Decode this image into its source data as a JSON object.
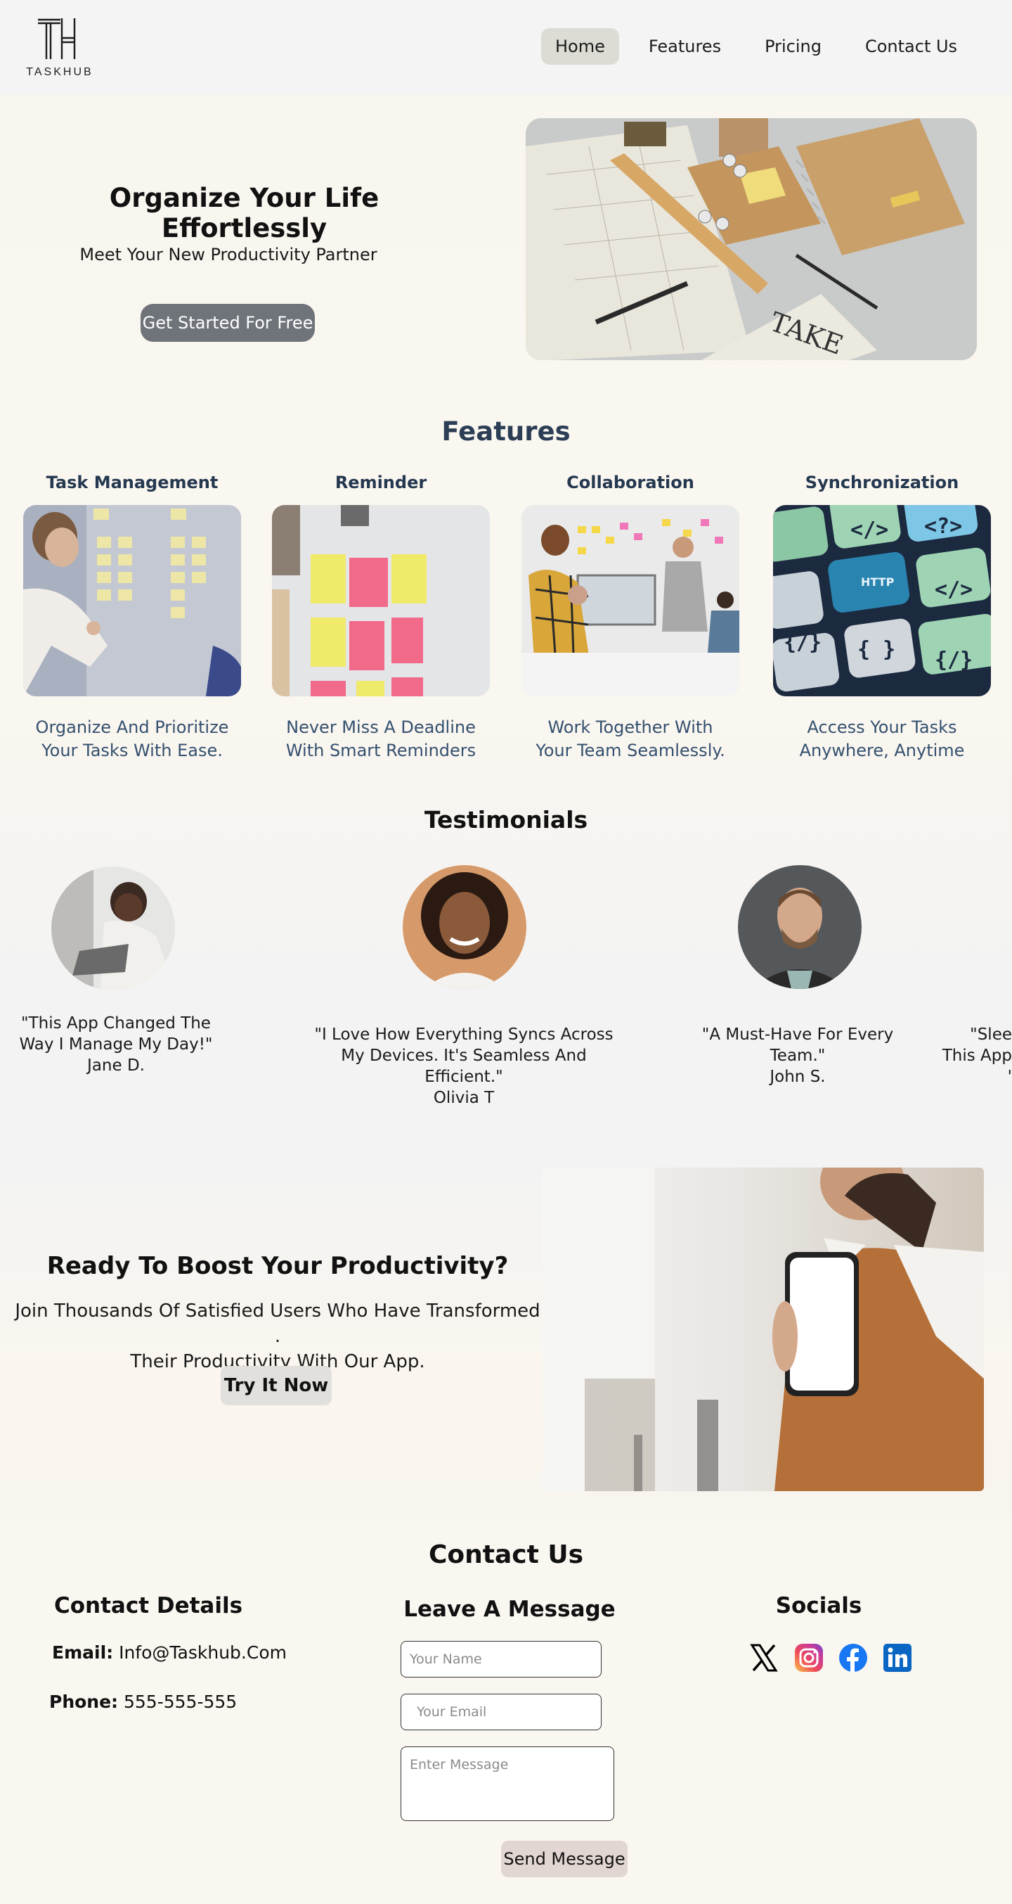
{
  "brand": {
    "name": "TASKHUB"
  },
  "nav": {
    "items": [
      {
        "label": "Home"
      },
      {
        "label": "Features"
      },
      {
        "label": "Pricing"
      },
      {
        "label": "Contact Us"
      }
    ]
  },
  "hero": {
    "title": "Organize Your Life Effortlessly",
    "subtitle": "Meet Your New Productivity Partner",
    "cta_label": "Get Started For Free"
  },
  "features": {
    "title": "Features",
    "items": [
      {
        "name": "Task Management",
        "desc_line1": "Organize And Prioritize",
        "desc_line2": "Your Tasks With Ease."
      },
      {
        "name": "Reminder",
        "desc_line1": "Never Miss A Deadline",
        "desc_line2": "With Smart Reminders"
      },
      {
        "name": "Collaboration",
        "desc_line1": "Work Together With",
        "desc_line2": "Your Team Seamlessly."
      },
      {
        "name": "Synchronization",
        "desc_line1": "Access Your Tasks",
        "desc_line2": "Anywhere, Anytime"
      }
    ]
  },
  "testimonials": {
    "title": "Testimonials",
    "items": [
      {
        "line1": "\"This App Changed The",
        "line2": "Way I Manage My Day!\"",
        "author": "Jane D."
      },
      {
        "line1": "\"I Love How Everything Syncs Across",
        "line2": "My Devices. It's Seamless And Efficient.\"",
        "author": "Olivia T"
      },
      {
        "line1": "\"A Must-Have For Every Team.\"",
        "author": "John S."
      },
      {
        "line1": "\"Slee",
        "line2": "This App",
        "author": "'"
      }
    ]
  },
  "cta": {
    "title": "Ready To Boost Your Productivity?",
    "line1": "Join Thousands Of Satisfied Users Who Have Transformed .",
    "line2": "Their Productivity With Our App.",
    "button": "Try It Now"
  },
  "contact": {
    "title": "Contact Us",
    "details_heading": "Contact Details",
    "email_label": "Email:",
    "email_value": "Info@Taskhub.Com",
    "phone_label": "Phone:",
    "phone_value": "555-555-555",
    "message_heading": "Leave A Message",
    "name_placeholder": "Your Name",
    "email_placeholder": "Your Email",
    "message_placeholder": "Enter Message",
    "send_label": "Send Message",
    "socials_heading": "Socials",
    "socials": [
      "x-icon",
      "instagram-icon",
      "facebook-icon",
      "linkedin-icon"
    ]
  },
  "colors": {
    "nav_active": "#dcdcd4",
    "hero_button": "#6f737a",
    "feature_heading": "#24384f",
    "feature_text": "#34506e",
    "send_button": "#e2d6d2"
  }
}
